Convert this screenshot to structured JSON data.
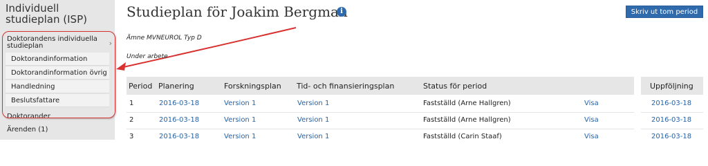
{
  "sidebar": {
    "title": "Individuell studieplan (ISP)",
    "main_item": "Doktorandens individuella studieplan",
    "sub_items": [
      "Doktorandinformation",
      "Doktorandinformation övrig",
      "Handledning",
      "Beslutsfattare"
    ],
    "other_items": [
      "Doktorander",
      "Ärenden (1)"
    ]
  },
  "header": {
    "title": "Studieplan för Joakim Bergman",
    "info_icon": "info-icon",
    "print_button": "Skriv ut tom period"
  },
  "meta": {
    "subject": "Ämne MVNEUROL Typ D",
    "status": "Under arbete"
  },
  "table": {
    "headers": [
      "Period",
      "Planering",
      "Forskningsplan",
      "Tid- och finansieringsplan",
      "Status för period",
      "Uppföljning"
    ],
    "rows": [
      {
        "period": "1",
        "planering": "2016-03-18",
        "forskningsplan": "Version 1",
        "tidplan": "Version 1",
        "status": "Fastställd (Arne Hallgren)",
        "visa": "Visa",
        "uppfoljning": "2016-03-18"
      },
      {
        "period": "2",
        "planering": "2016-03-18",
        "forskningsplan": "Version 1",
        "tidplan": "Version 1",
        "status": "Fastställd (Arne Hallgren)",
        "visa": "Visa",
        "uppfoljning": "2016-03-18"
      },
      {
        "period": "3",
        "planering": "2016-03-18",
        "forskningsplan": "Version 1",
        "tidplan": "Version 1",
        "status": "Fastställd (Carin Staaf)",
        "visa": "Visa",
        "uppfoljning": "2016-03-18"
      }
    ]
  },
  "colors": {
    "accent": "#2f6aad",
    "link": "#2563a8",
    "annotation": "#d93030",
    "sidebar_bg": "#e6e6e6"
  }
}
